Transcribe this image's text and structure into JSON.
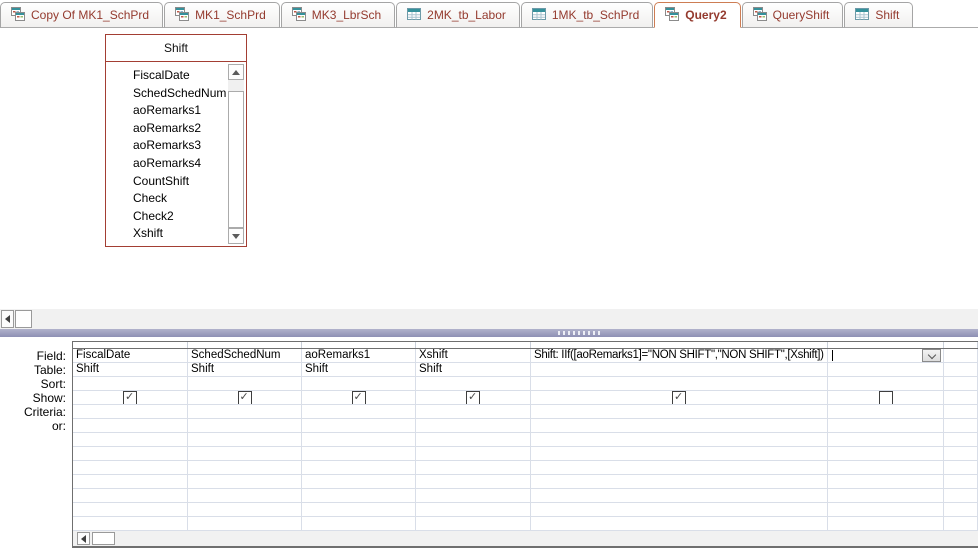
{
  "window": {
    "app": "Microsoft Access",
    "view": "Query Design"
  },
  "tabs": [
    {
      "label": "Copy Of MK1_SchPrd",
      "icon": "query-icon",
      "active": false
    },
    {
      "label": "MK1_SchPrd",
      "icon": "query-icon",
      "active": false
    },
    {
      "label": "MK3_LbrSch",
      "icon": "query-icon",
      "active": false
    },
    {
      "label": "2MK_tb_Labor",
      "icon": "table-icon",
      "active": false
    },
    {
      "label": "1MK_tb_SchPrd",
      "icon": "table-icon",
      "active": false
    },
    {
      "label": "Query2",
      "icon": "query-icon",
      "active": true
    },
    {
      "label": "QueryShift",
      "icon": "query-icon",
      "active": false
    },
    {
      "label": "Shift",
      "icon": "table-icon",
      "active": false
    }
  ],
  "field_list": {
    "title": "Shift",
    "fields": [
      "FiscalDate",
      "SchedSchedNum",
      "aoRemarks1",
      "aoRemarks2",
      "aoRemarks3",
      "aoRemarks4",
      "CountShift",
      "Check",
      "Check2",
      "Xshift"
    ]
  },
  "design_grid": {
    "row_labels": [
      "Field:",
      "Table:",
      "Sort:",
      "Show:",
      "Criteria:",
      "or:"
    ],
    "columns": [
      {
        "field": "FiscalDate",
        "table": "Shift",
        "sort": "",
        "show": true,
        "criteria": "",
        "or": "",
        "active": false
      },
      {
        "field": "SchedSchedNum",
        "table": "Shift",
        "sort": "",
        "show": true,
        "criteria": "",
        "or": "",
        "active": false
      },
      {
        "field": "aoRemarks1",
        "table": "Shift",
        "sort": "",
        "show": true,
        "criteria": "",
        "or": "",
        "active": false
      },
      {
        "field": "Xshift",
        "table": "Shift",
        "sort": "",
        "show": true,
        "criteria": "",
        "or": "",
        "active": false
      },
      {
        "field": "Shift: IIf([aoRemarks1]=\"NON SHIFT\",\"NON SHIFT\",[Xshift])",
        "table": "",
        "sort": "",
        "show": true,
        "criteria": "",
        "or": "",
        "active": false
      },
      {
        "field": "",
        "table": "",
        "sort": "",
        "show": false,
        "criteria": "",
        "or": "",
        "active": true
      }
    ],
    "empty_row_count": 7
  },
  "colors": {
    "tab_text": "#943a2e",
    "active_tab_border": "#cd7d54",
    "field_list_border": "#a33e33",
    "splitter": "#8e90b4",
    "grid_line": "#d9dee8",
    "grid_border": "#6f6f6f",
    "scrollbar_track": "#f1f1f1"
  }
}
